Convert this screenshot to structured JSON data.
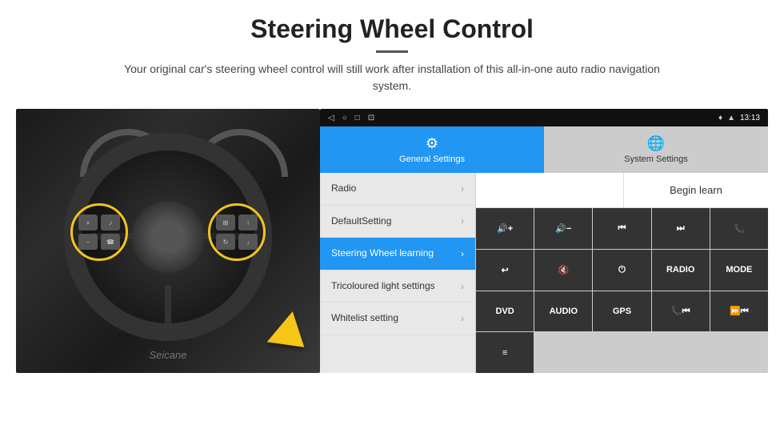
{
  "header": {
    "title": "Steering Wheel Control",
    "subtitle": "Your original car's steering wheel control will still work after installation of this all-in-one auto radio navigation system."
  },
  "statusbar": {
    "nav_icons": [
      "◁",
      "○",
      "□",
      "⊡"
    ],
    "gps_icon": "♦",
    "wifi_icon": "▲",
    "time": "13:13"
  },
  "tabs": [
    {
      "label": "General Settings",
      "active": true,
      "icon": "⚙"
    },
    {
      "label": "System Settings",
      "active": false,
      "icon": "🌐"
    }
  ],
  "menu": [
    {
      "label": "Radio",
      "active": false
    },
    {
      "label": "DefaultSetting",
      "active": false
    },
    {
      "label": "Steering Wheel learning",
      "active": true
    },
    {
      "label": "Tricoloured light settings",
      "active": false
    },
    {
      "label": "Whitelist setting",
      "active": false
    }
  ],
  "right_panel": {
    "begin_learn_label": "Begin learn",
    "buttons": [
      {
        "label": "🔊+",
        "row": 1,
        "col": 1
      },
      {
        "label": "🔊-",
        "row": 1,
        "col": 2
      },
      {
        "label": "⏮",
        "row": 1,
        "col": 3
      },
      {
        "label": "⏭",
        "row": 1,
        "col": 4
      },
      {
        "label": "📞",
        "row": 1,
        "col": 5
      },
      {
        "label": "↩",
        "row": 2,
        "col": 1
      },
      {
        "label": "🔇",
        "row": 2,
        "col": 2
      },
      {
        "label": "⏻",
        "row": 2,
        "col": 3
      },
      {
        "label": "RADIO",
        "row": 2,
        "col": 4
      },
      {
        "label": "MODE",
        "row": 2,
        "col": 5
      },
      {
        "label": "DVD",
        "row": 3,
        "col": 1
      },
      {
        "label": "AUDIO",
        "row": 3,
        "col": 2
      },
      {
        "label": "GPS",
        "row": 3,
        "col": 3
      },
      {
        "label": "📞⏮",
        "row": 3,
        "col": 4
      },
      {
        "label": "⏩⏮",
        "row": 3,
        "col": 5
      },
      {
        "label": "≡",
        "row": 4,
        "col": 1
      }
    ]
  },
  "seicane_logo": "Seicane"
}
